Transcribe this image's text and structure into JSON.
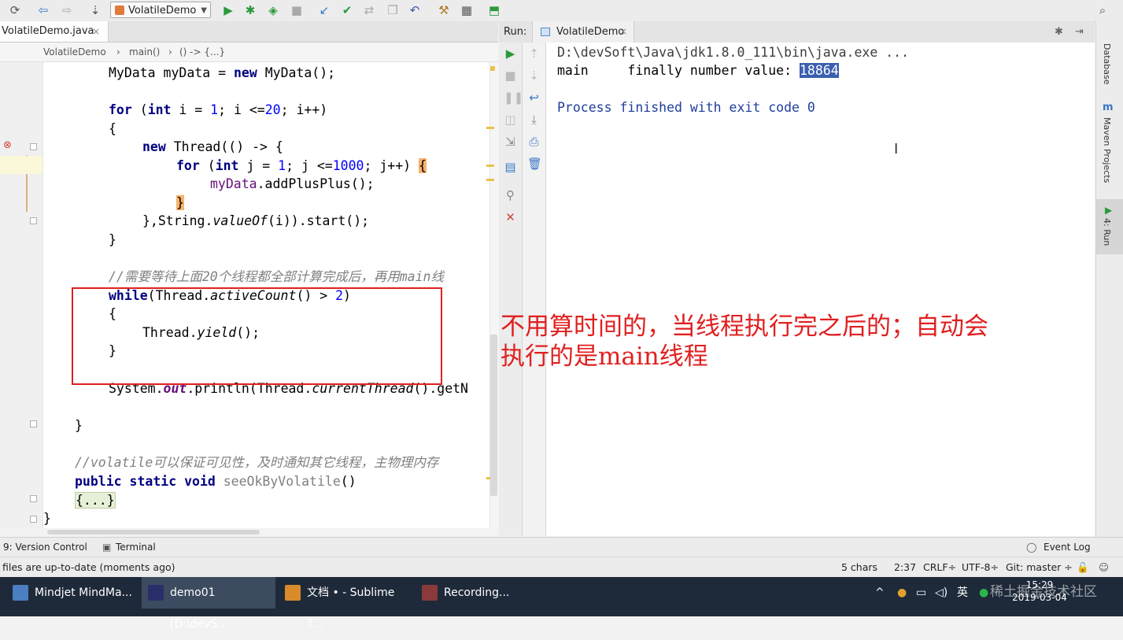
{
  "toolbar": {
    "run_config": "VolatileDemo",
    "accent": "#2b9a3c"
  },
  "editor": {
    "tab_label": "VolatileDemo.java",
    "tab_close": "×",
    "breadcrumb": [
      "VolatileDemo",
      "main()",
      "() -> {...}"
    ],
    "code": {
      "l1_a": "MyData myData = ",
      "l1_kw": "new",
      "l1_b": " MyData();",
      "l3_kw1": "for",
      "l3_b": " (",
      "l3_kw2": "int",
      "l3_c": " i = ",
      "l3_n1": "1",
      "l3_d": "; i <=",
      "l3_n2": "20",
      "l3_e": "; i++)",
      "l4": "{",
      "l5_kw": "new",
      "l5_b": " Thread(() -> {",
      "l6_kw1": "for",
      "l6_b": " (",
      "l6_kw2": "int",
      "l6_c": " j = ",
      "l6_n1": "1",
      "l6_d": "; j <=",
      "l6_n2": "1000",
      "l6_e": "; j++) ",
      "l6_brace": "{",
      "l7_a": "myData",
      "l7_b": ".addPlusPlus();",
      "l8_brace": "}",
      "l9_a": "},String.",
      "l9_it": "valueOf",
      "l9_b": "(i)).start();",
      "l10": "}",
      "l12_cmt": "//需要等待上面20个线程都全部计算完成后，再用main线",
      "l13_kw": "while",
      "l13_a": "(Thread.",
      "l13_it": "activeCount",
      "l13_b": "() > ",
      "l13_n": "2",
      "l13_c": ")",
      "l14": "{",
      "l15_a": "Thread.",
      "l15_it": "yield",
      "l15_b": "();",
      "l16": "}",
      "l18_a": "System.",
      "l18_fld": "out",
      "l18_b": ".println(Thread.",
      "l18_it": "currentThread",
      "l18_c": "().getN",
      "l20": "}",
      "l22_cmt": "//volatile可以保证可见性，及时通知其它线程，主物理内存",
      "l23_kw": "public static void",
      "l23_m": " seeOkByVolatile",
      "l23_b": "()",
      "l24_fold": "{...}",
      "l25": "}"
    }
  },
  "annotation": {
    "line1": "不用算时间的，当线程执行完之后的；自动会",
    "line2": "执行的是main线程",
    "color": "#e02020"
  },
  "run_panel": {
    "label": "Run:",
    "tab": "VolatileDemo",
    "tab_close": "×",
    "console": {
      "cmd": "D:\\devSoft\\Java\\jdk1.8.0_111\\bin\\java.exe ...",
      "out_prefix": "main     finally number value: ",
      "out_value": "18864",
      "exit": "Process finished with exit code 0"
    }
  },
  "right_strip": [
    "Database",
    "Maven Projects",
    "4: Run"
  ],
  "tool_windows": {
    "version_control": "9: Version Control",
    "terminal": "Terminal",
    "event_log": "Event Log"
  },
  "status": {
    "message": "files are up-to-date (moments ago)",
    "chars": "5 chars",
    "position": "2:37",
    "line_sep": "CRLF÷",
    "encoding": "UTF-8÷",
    "git": "Git: master ÷"
  },
  "taskbar": {
    "items": [
      "Mindjet MindMa...",
      "demo01 [D:\\devS...",
      "文档 • - Sublime T...",
      "Recording..."
    ],
    "ime": "英",
    "time": "15:29",
    "date": "2019-03-04",
    "watermark": "稀土掘金技术社区"
  }
}
